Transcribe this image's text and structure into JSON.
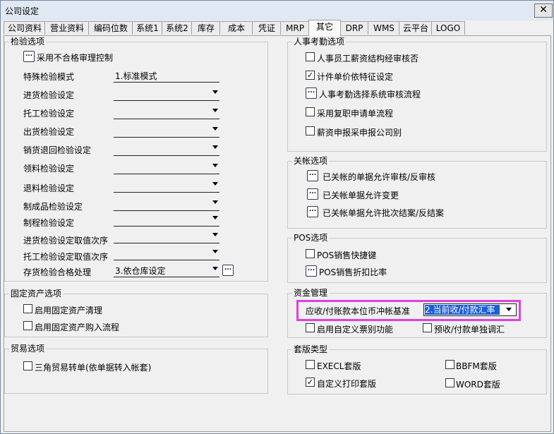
{
  "window": {
    "title": "公司设定",
    "close_glyph": "✕"
  },
  "tabs": [
    "公司资料",
    "营业资料",
    "编码位数",
    "系统1",
    "系统2",
    "库存",
    "成本",
    "凭证",
    "MRP",
    "其它",
    "DRP",
    "WMS",
    "云平台",
    "LOGO"
  ],
  "inspection": {
    "title": "检验选项",
    "reject_control": "采用不合格审理控制",
    "rows": [
      {
        "label": "特殊检验模式",
        "value": "1.标准模式"
      },
      {
        "label": "进货检验设定",
        "value": ""
      },
      {
        "label": "托工检验设定",
        "value": ""
      },
      {
        "label": "出货检验设定",
        "value": ""
      },
      {
        "label": "销货退回检验设定",
        "value": ""
      },
      {
        "label": "领料检验设定",
        "value": ""
      },
      {
        "label": "退料检验设定",
        "value": ""
      },
      {
        "label": "制成品检验设定",
        "value": ""
      },
      {
        "label": "制程检验设定",
        "value": ""
      },
      {
        "label": "进货检验设定取值次序",
        "value": ""
      },
      {
        "label": "托工检验设定取值次序",
        "value": ""
      },
      {
        "label": "存货检验合格处理",
        "value": "3.依仓库设定"
      }
    ]
  },
  "fixed_assets": {
    "title": "固定资产选项",
    "items": [
      "启用固定资产清理",
      "启用固定资产购入流程"
    ]
  },
  "trade": {
    "title": "贸易选项",
    "items": [
      "三角贸易转单(依单据转入帐套)"
    ]
  },
  "hr": {
    "title": "人事考勤选项",
    "salary_review": "人事员工薪资结构经审核否",
    "piece_rate": "计件单价依特征设定",
    "attendance_flow": "人事考勤选择系统审核流程",
    "overtime_flow": "采用复职申请单流程",
    "salary_by_company": "薪资申报采申报公司别"
  },
  "closing": {
    "title": "关帐选项",
    "items": [
      "已关帐的单据允许审核/反审核",
      "已关帐单据允许变更",
      "已关帐单据允许批次结案/反结案"
    ]
  },
  "pos": {
    "title": "POS选项",
    "shortcut": "POS销售快捷键",
    "discount": "POS销售折扣比率"
  },
  "funds": {
    "title": "资金管理",
    "offset_label": "应收/付账款本位币冲帐基准",
    "offset_value": "2.当前收/付款汇率",
    "custom_bill": "启用自定义票别功能",
    "separate_rate": "预收/付款单独调汇"
  },
  "templates": {
    "title": "套版类型",
    "items": [
      {
        "label": "EXECL套版",
        "checked": false
      },
      {
        "label": "BBFM套版",
        "checked": false
      },
      {
        "label": "自定义打印套版",
        "checked": true
      },
      {
        "label": "WORD套版",
        "checked": false
      }
    ]
  },
  "glyphs": {
    "dots": "...",
    "check": "✓"
  }
}
